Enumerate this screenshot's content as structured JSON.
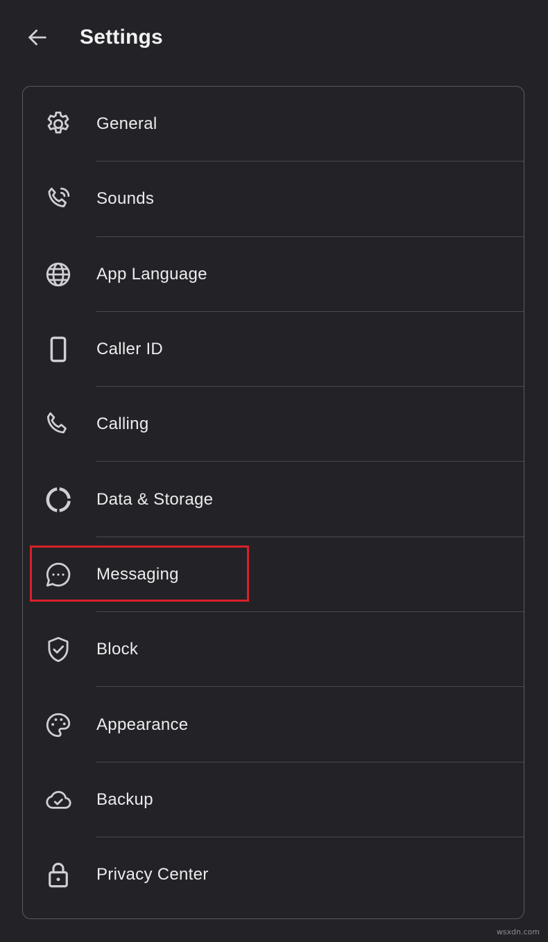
{
  "header": {
    "title": "Settings",
    "back_icon": "arrow-left-icon"
  },
  "settings": {
    "items": [
      {
        "label": "General",
        "icon": "gear-icon"
      },
      {
        "label": "Sounds",
        "icon": "phone-ringing-icon"
      },
      {
        "label": "App Language",
        "icon": "globe-icon"
      },
      {
        "label": "Caller ID",
        "icon": "smartphone-icon"
      },
      {
        "label": "Calling",
        "icon": "phone-icon"
      },
      {
        "label": "Data & Storage",
        "icon": "donut-chart-icon"
      },
      {
        "label": "Messaging",
        "icon": "chat-bubble-icon"
      },
      {
        "label": "Block",
        "icon": "shield-check-icon"
      },
      {
        "label": "Appearance",
        "icon": "palette-icon"
      },
      {
        "label": "Backup",
        "icon": "cloud-check-icon"
      },
      {
        "label": "Privacy Center",
        "icon": "lock-icon"
      }
    ]
  },
  "highlight": {
    "target": "Messaging",
    "color": "#d8202a"
  },
  "watermark": "wsxdn.com",
  "colors": {
    "background": "#232327",
    "text": "#eeeef0",
    "icon": "#d0d0d4",
    "divider": "#4a4a4f",
    "card_border": "#5a5a5f"
  }
}
